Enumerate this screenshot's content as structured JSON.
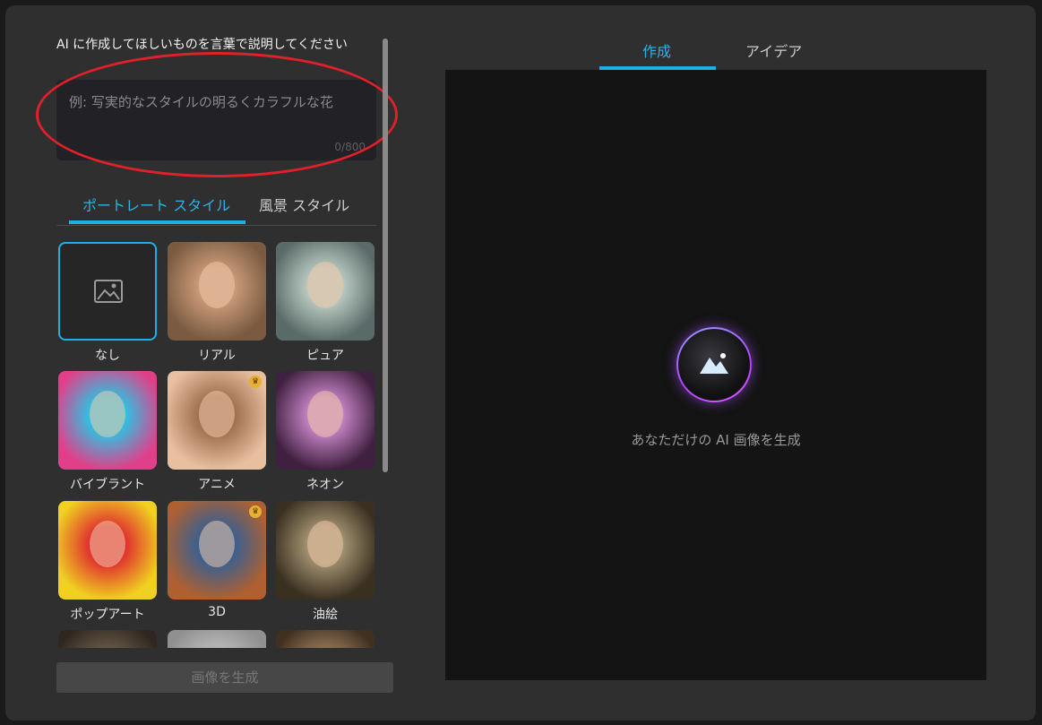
{
  "prompt": {
    "title": "AI に作成してほしいものを言葉で説明してください",
    "placeholder": "例: 写実的なスタイルの明るくカラフルな花",
    "counter": "0/800"
  },
  "style_tabs": [
    {
      "label": "ポートレート スタイル",
      "active": true
    },
    {
      "label": "風景 スタイル",
      "active": false
    }
  ],
  "styles": [
    {
      "label": "なし",
      "icon": "image-icon",
      "selected": true
    },
    {
      "label": "リアル",
      "colors": [
        "#7a5a40",
        "#c89a78"
      ]
    },
    {
      "label": "ピュア",
      "colors": [
        "#5a6a68",
        "#b8c8c0"
      ]
    },
    {
      "label": "バイブラント",
      "colors": [
        "#e0408a",
        "#30c0e0"
      ]
    },
    {
      "label": "アニメ",
      "colors": [
        "#e8c0a0",
        "#a07050"
      ],
      "premium": true
    },
    {
      "label": "ネオン",
      "colors": [
        "#402040",
        "#c080c0"
      ]
    },
    {
      "label": "ポップアート",
      "colors": [
        "#f0d020",
        "#e03030"
      ]
    },
    {
      "label": "3D",
      "colors": [
        "#b06030",
        "#3a6090"
      ],
      "premium": true
    },
    {
      "label": "油絵",
      "colors": [
        "#3a3020",
        "#a09070"
      ]
    },
    {
      "label": "",
      "colors": [
        "#302820",
        "#706050"
      ]
    },
    {
      "label": "",
      "colors": [
        "#909090",
        "#c0c0c0"
      ]
    },
    {
      "label": "",
      "colors": [
        "#403020",
        "#a08060"
      ]
    }
  ],
  "generate_button": "画像を生成",
  "right_tabs": [
    {
      "label": "作成",
      "active": true
    },
    {
      "label": "アイデア",
      "active": false
    }
  ],
  "preview": {
    "text": "あなただけの AI 画像を生成"
  },
  "colors": {
    "accent": "#1fb0e3",
    "annotation": "#e0202a"
  }
}
